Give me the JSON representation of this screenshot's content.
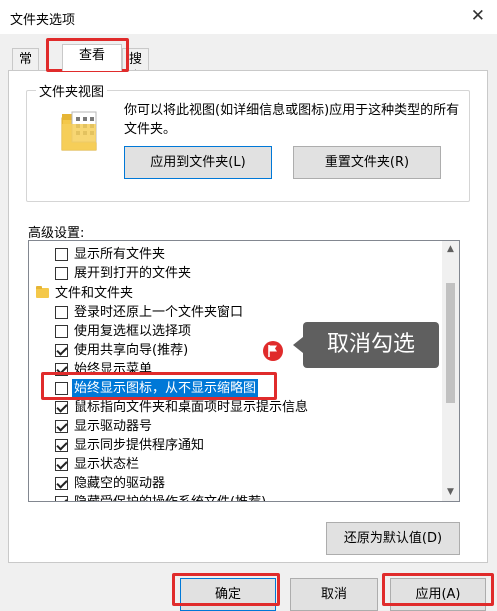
{
  "window": {
    "title": "文件夹选项",
    "close_glyph": "✕"
  },
  "tabs": [
    {
      "label": "常规"
    },
    {
      "label": "查看"
    },
    {
      "label": "搜索"
    }
  ],
  "folder_views": {
    "legend": "文件夹视图",
    "description": "你可以将此视图(如详细信息或图标)应用于这种类型的所有文件夹。",
    "apply_button": "应用到文件夹(L)",
    "reset_button": "重置文件夹(R)"
  },
  "advanced": {
    "label": "高级设置:",
    "items": [
      {
        "text": "显示所有文件夹",
        "type": "checkbox",
        "checked": false
      },
      {
        "text": "展开到打开的文件夹",
        "type": "checkbox",
        "checked": false
      },
      {
        "text": "文件和文件夹",
        "type": "folder"
      },
      {
        "text": "登录时还原上一个文件夹窗口",
        "type": "checkbox",
        "checked": false
      },
      {
        "text": "使用复选框以选择项",
        "type": "checkbox",
        "checked": false
      },
      {
        "text": "使用共享向导(推荐)",
        "type": "checkbox",
        "checked": true
      },
      {
        "text": "始终显示菜单",
        "type": "checkbox",
        "checked": true
      },
      {
        "text": "始终显示图标，从不显示缩略图",
        "type": "checkbox",
        "checked": false,
        "selected": true
      },
      {
        "text": "鼠标指向文件夹和桌面项时显示提示信息",
        "type": "checkbox",
        "checked": true
      },
      {
        "text": "显示驱动器号",
        "type": "checkbox",
        "checked": true
      },
      {
        "text": "显示同步提供程序通知",
        "type": "checkbox",
        "checked": true
      },
      {
        "text": "显示状态栏",
        "type": "checkbox",
        "checked": true
      },
      {
        "text": "隐藏空的驱动器",
        "type": "checkbox",
        "checked": true
      },
      {
        "text": "隐藏受保护的操作系统文件(推荐)",
        "type": "checkbox",
        "checked": true
      }
    ],
    "restore_button": "还原为默认值(D)"
  },
  "annotation": {
    "callout_text": "取消勾选"
  },
  "footer": {
    "ok": "确定",
    "cancel": "取消",
    "apply": "应用(A)"
  },
  "colors": {
    "highlight_red": "#e02b2b",
    "selection_blue": "#0078d7",
    "callout_bg": "#5f5f5f"
  }
}
